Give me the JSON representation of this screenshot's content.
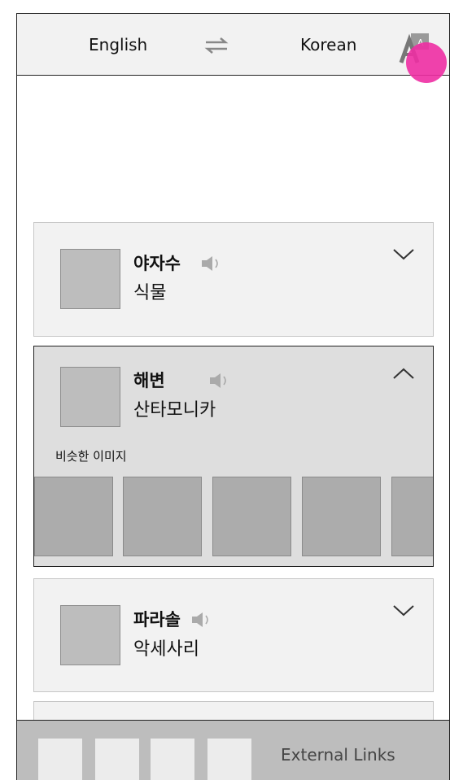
{
  "header": {
    "source_language": "English",
    "target_language": "Korean",
    "accent_color": "#ee2ea3"
  },
  "results": [
    {
      "word": "야자수",
      "category": "식물",
      "expanded": false
    },
    {
      "word": "해변",
      "category": "산타모니카",
      "expanded": true,
      "similar_label": "비슷한 이미지"
    },
    {
      "word": "파라솔",
      "category": "악세사리",
      "expanded": false
    }
  ],
  "footer": {
    "external_links_label": "External Links"
  },
  "icons": {
    "swap": "swap-arrows-icon",
    "translate": "translate-icon",
    "speaker": "speaker-icon",
    "chevron_down": "chevron-down-icon",
    "chevron_up": "chevron-up-icon"
  }
}
